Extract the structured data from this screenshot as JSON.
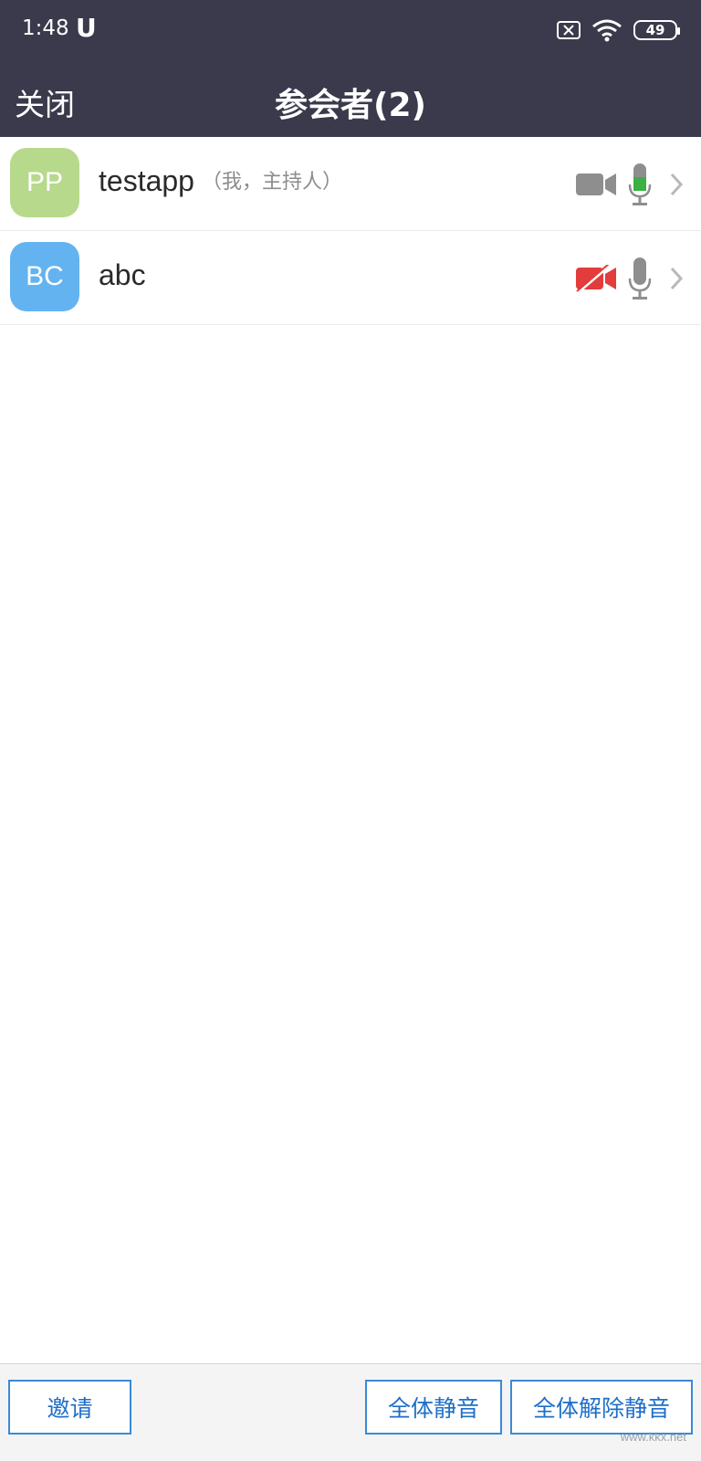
{
  "status_bar": {
    "time": "1:48",
    "app_indicator": "U",
    "battery": "49",
    "icons": [
      "sim-x-icon",
      "wifi-icon",
      "battery-icon"
    ]
  },
  "header": {
    "close_label": "关闭",
    "title": "参会者(2)"
  },
  "participants": [
    {
      "initials": "PP",
      "avatar_color": "#b7d98b",
      "name": "testapp",
      "role": "（我，主持人）",
      "camera": "on",
      "mic": "active"
    },
    {
      "initials": "BC",
      "avatar_color": "#63b3f1",
      "name": "abc",
      "role": "",
      "camera": "off",
      "mic": "idle"
    }
  ],
  "footer": {
    "invite_label": "邀请",
    "mute_all_label": "全体静音",
    "unmute_all_label": "全体解除静音"
  },
  "watermark": "www.kkx.net",
  "colors": {
    "header_bg": "#3a3a4c",
    "mic_active": "#3cb043",
    "camera_off": "#e23c3c",
    "icon_gray": "#8e8e8e",
    "button_blue": "#1e6fc8"
  }
}
